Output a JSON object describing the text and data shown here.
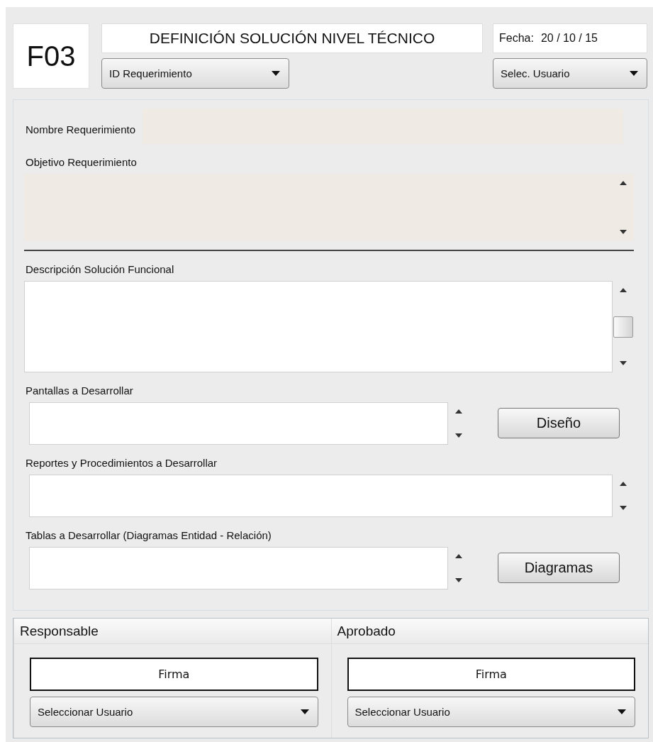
{
  "header": {
    "code": "F03",
    "title": "DEFINICIÓN SOLUCIÓN NIVEL TÉCNICO",
    "date_label": "Fecha:",
    "date_value": "20 / 10 / 15",
    "requirement_select": "ID Requerimiento",
    "user_select": "Selec. Usuario"
  },
  "requirement": [
    {
      "label": "Nombre Requerimiento",
      "kind": "inline",
      "readonly": true,
      "scrollbar": false
    },
    {
      "label": "Objetivo Requerimiento",
      "kind": "medium",
      "readonly": true,
      "scrollbar": true,
      "thumb": false
    }
  ],
  "solution": [
    {
      "label": "Descripción Solución Funcional",
      "kind": "tall",
      "readonly": false,
      "scrollbar": true,
      "thumb": true
    },
    {
      "label": "Pantallas a Desarrollar",
      "kind": "short",
      "readonly": false,
      "scrollbar": true,
      "thumb": false,
      "button": "Diseño"
    },
    {
      "label": "Reportes y Procedimientos a Desarrollar",
      "kind": "short",
      "readonly": false,
      "scrollbar": true,
      "thumb": false
    },
    {
      "label": "Tablas a Desarrollar (Diagramas Entidad - Relación)",
      "kind": "short",
      "readonly": false,
      "scrollbar": true,
      "thumb": false,
      "button": "Diagramas"
    }
  ],
  "signatures": [
    {
      "role": "Responsable",
      "signature": "Firma",
      "select": "Seleccionar Usuario"
    },
    {
      "role": "Aprobado",
      "signature": "Firma",
      "select": "Seleccionar Usuario"
    }
  ]
}
